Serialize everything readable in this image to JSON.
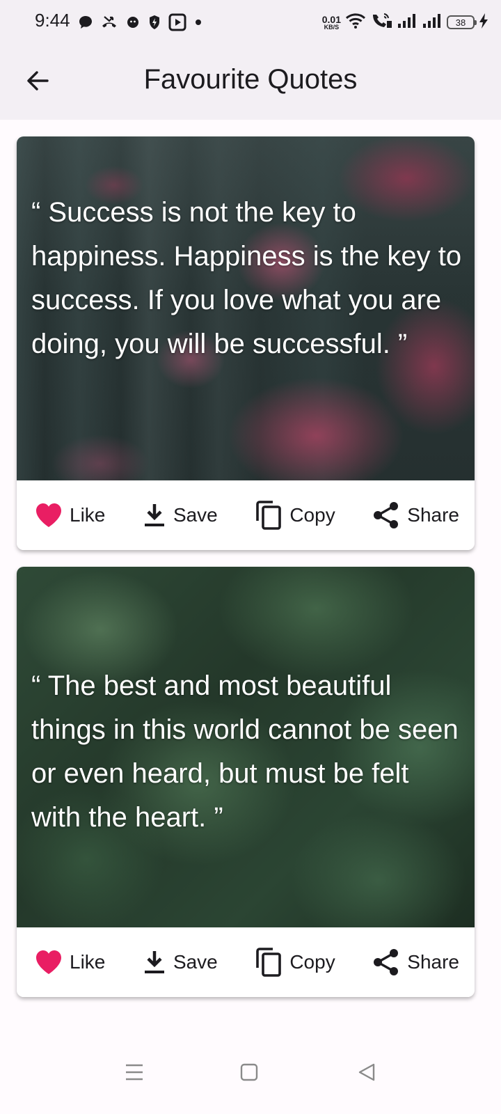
{
  "status_bar": {
    "time": "9:44",
    "net_speed_value": "0.01",
    "net_speed_unit": "KB/S",
    "battery_level": "38",
    "icons": [
      "chat-bubble-icon",
      "missed-call-icon",
      "app-notification-icon",
      "shield-icon",
      "video-play-icon",
      "more-dot-icon",
      "wifi-icon",
      "volte-call-icon",
      "signal-icon",
      "signal-icon",
      "battery-icon",
      "charging-icon"
    ]
  },
  "app_bar": {
    "title": "Favourite Quotes",
    "back_icon": "arrow-left-icon"
  },
  "quotes": [
    {
      "text": "“ Success is not the key to happiness. Happiness is the key to success. If you love what you are doing, you will be successful. ”",
      "image": "pink-blossom-branches-background",
      "actions": {
        "like": "Like",
        "save": "Save",
        "copy": "Copy",
        "share": "Share"
      }
    },
    {
      "text": "“ The best and most beautiful things in this world cannot be seen or even heard, but must be felt with the heart. ”",
      "image": "monstera-leaves-background",
      "actions": {
        "like": "Like",
        "save": "Save",
        "copy": "Copy",
        "share": "Share"
      }
    }
  ],
  "colors": {
    "app_bar_bg": "#f3eff4",
    "page_bg": "#fffbfe",
    "like_heart": "#e91e63",
    "text": "#1c1b1f"
  },
  "nav_bar": {
    "icons": [
      "menu-icon",
      "home-square-icon",
      "back-triangle-icon"
    ]
  }
}
